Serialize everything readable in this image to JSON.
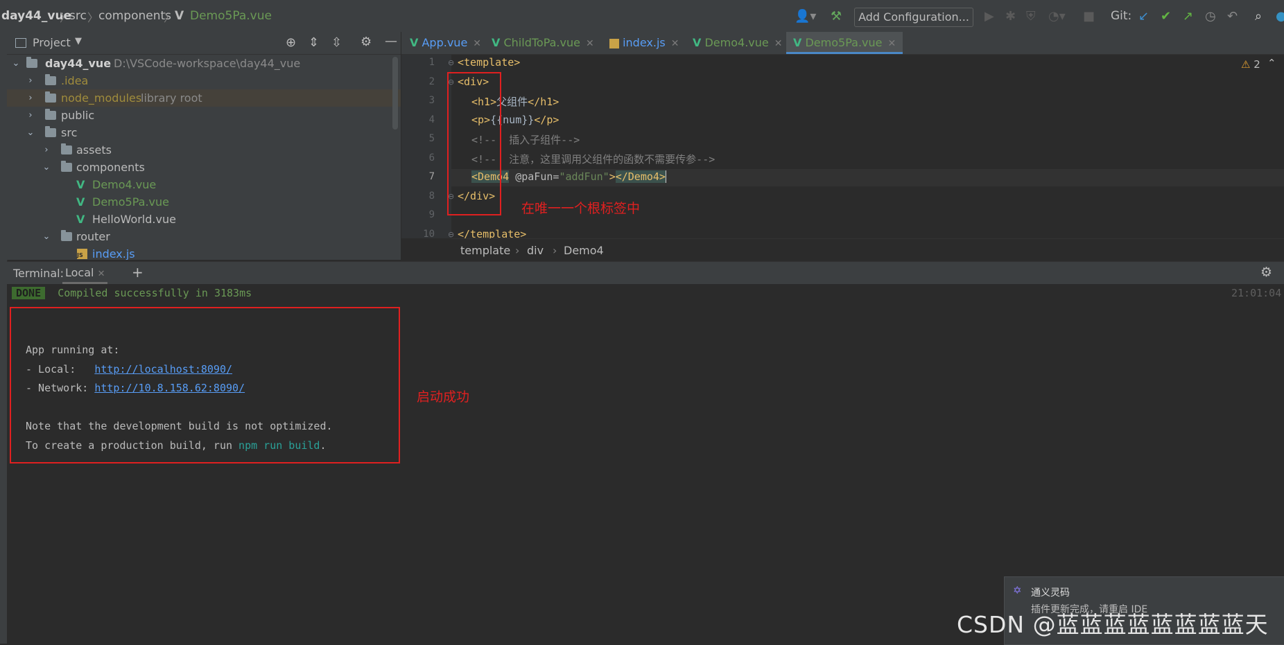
{
  "navbar": {
    "project": "day44_vue",
    "crumbs": [
      "src",
      "components"
    ],
    "file": "Demo5Pa.vue",
    "add_config": "Add Configuration...",
    "git_label": "Git:"
  },
  "project_panel": {
    "title": "Project",
    "tree": [
      {
        "label": "day44_vue",
        "extra": "D:\\VSCode-workspace\\day44_vue",
        "type": "folder",
        "expanded": true
      },
      {
        "label": ".idea",
        "type": "folder"
      },
      {
        "label": "node_modules",
        "extra": "library root",
        "type": "folder"
      },
      {
        "label": "public",
        "type": "folder"
      },
      {
        "label": "src",
        "type": "folder",
        "expanded": true
      },
      {
        "label": "assets",
        "type": "folder"
      },
      {
        "label": "components",
        "type": "folder",
        "expanded": true
      },
      {
        "label": "Demo4.vue",
        "type": "vue"
      },
      {
        "label": "Demo5Pa.vue",
        "type": "vue"
      },
      {
        "label": "HelloWorld.vue",
        "type": "vue"
      },
      {
        "label": "router",
        "type": "folder",
        "expanded": true
      },
      {
        "label": "index.js",
        "type": "js"
      }
    ]
  },
  "tabs": [
    "App.vue",
    "ChildToPa.vue",
    "index.js",
    "Demo4.vue",
    "Demo5Pa.vue"
  ],
  "editor": {
    "line_numbers": [
      "1",
      "2",
      "3",
      "4",
      "5",
      "6",
      "7",
      "8",
      "9",
      "10"
    ],
    "warnings": "2",
    "lines": {
      "l1": "<template>",
      "l2": "<div>",
      "l3_open": "<h1>",
      "l3_text": "父组件",
      "l3_close": "</h1>",
      "l4_open": "<p>",
      "l4_text": "{{num}}",
      "l4_close": "</p>",
      "l5": "<!--  插入子组件-->",
      "l6": "<!--  注意，这里调用父组件的函数不需要传参-->",
      "l7_open": "<Demo4",
      "l7_attr": " @paFun=",
      "l7_str": "\"addFun\"",
      "l7_close1": ">",
      "l7_close2": "</Demo4>",
      "l8": "</div>",
      "l10": "</template>"
    },
    "breadcrumb": [
      "template",
      "div",
      "Demo4"
    ],
    "annotation": "在唯一一个根标签中"
  },
  "terminal": {
    "label": "Terminal:",
    "tab": "Local",
    "done": "DONE",
    "compiled": "Compiled successfully in 3183ms",
    "time": "21:01:04",
    "app_running": "App running at:",
    "local_label": "- Local:   ",
    "local_url": "http://localhost:8090/",
    "network_label": "- Network: ",
    "network_url": "http://10.8.158.62:8090/",
    "note": "Note that the development build is not optimized.",
    "prod_prefix": "To create a production build, run ",
    "prod_cmd": "npm run build",
    "prod_suffix": ".",
    "annotation": "启动成功"
  },
  "notification": {
    "title": "通义灵码",
    "body": "插件更新完成，请重启 IDE"
  },
  "watermark": "CSDN @蓝蓝蓝蓝蓝蓝蓝蓝天"
}
